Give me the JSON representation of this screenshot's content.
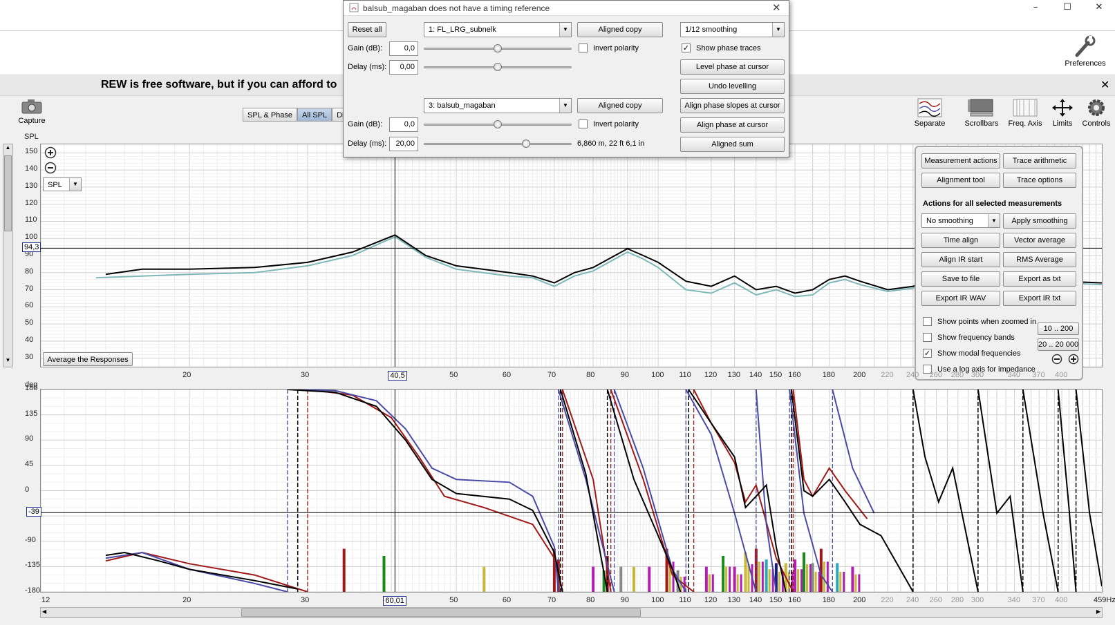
{
  "window": {
    "controls": [
      "–",
      "☐",
      "✕"
    ],
    "preferences_label": "Preferences",
    "banner": "REW is free software, but if you can afford to",
    "close_symbol": "✕"
  },
  "toolbar": {
    "capture_label": "Capture",
    "spl_axis_label": "SPL",
    "view_tabs": [
      "SPL & Phase",
      "All SPL",
      "Dist"
    ],
    "selected_tab": "All SPL",
    "right_tools": [
      "Separate",
      "Scrollbars",
      "Freq. Axis",
      "Limits",
      "Controls"
    ]
  },
  "dialog": {
    "title": "balsub_magaban does not have a timing reference",
    "reset_all": "Reset all",
    "meas1": {
      "name": "1: FL_LRG_subnelk",
      "aligned_copy": "Aligned copy",
      "gain_label": "Gain (dB):",
      "gain": "0,0",
      "invert_label": "Invert polarity",
      "delay_label": "Delay (ms):",
      "delay": "0,00"
    },
    "meas2": {
      "name": "3: balsub_magaban",
      "aligned_copy": "Aligned copy",
      "gain_label": "Gain (dB):",
      "gain": "0,0",
      "invert_label": "Invert polarity",
      "delay_label": "Delay (ms):",
      "delay": "20,00",
      "distance": "6,860 m, 22 ft 6,1 in"
    },
    "smoothing": "1/12 smoothing",
    "show_phase_traces": "Show phase traces",
    "show_phase_checked": true,
    "buttons": [
      "Level phase at cursor",
      "Undo levelling",
      "Align phase slopes at cursor",
      "Align phase at cursor",
      "Aligned sum"
    ]
  },
  "spl_chart": {
    "selector": "SPL",
    "y_ticks": [
      "150",
      "140",
      "130",
      "120",
      "110",
      "100",
      "90",
      "80",
      "70",
      "60",
      "50",
      "40",
      "30"
    ],
    "cursor_value": "94,3",
    "cursor_freq": "40,5",
    "x_ticks": [
      "20",
      "30",
      "40,5",
      "50",
      "60",
      "70",
      "80",
      "90",
      "100",
      "110",
      "120",
      "130",
      "140",
      "150",
      "160",
      "180",
      "200",
      "220",
      "240",
      "260",
      "280",
      "300",
      "340",
      "370",
      "400"
    ],
    "average_button": "Average the Responses"
  },
  "phase_chart": {
    "axis_label": "deg",
    "y_ticks": [
      "180",
      "135",
      "90",
      "45",
      "0",
      "-39",
      "-90",
      "-135",
      "-180"
    ],
    "cursor_value": "-39",
    "cursor_freq": "60,01",
    "x_ticks": [
      "12",
      "20",
      "30",
      "50",
      "60",
      "70",
      "80",
      "90",
      "100",
      "110",
      "120",
      "130",
      "140",
      "150",
      "160",
      "180",
      "200",
      "220",
      "240",
      "260",
      "280",
      "300",
      "340",
      "370",
      "400",
      "459Hz"
    ]
  },
  "panel": {
    "buttons_top": [
      "Measurement actions",
      "Trace arithmetic",
      "Alignment tool",
      "Trace options"
    ],
    "section_title": "Actions for all selected measurements",
    "smoothing": "No  smoothing",
    "buttons": [
      "Apply smoothing",
      "Time align",
      "Vector average",
      "Align IR start",
      "RMS Average",
      "Save to file",
      "Export as txt",
      "Export IR WAV",
      "Export IR txt"
    ],
    "checks": [
      {
        "label": "Show points when zoomed in",
        "checked": false
      },
      {
        "label": "Show frequency bands",
        "checked": false
      },
      {
        "label": "Show modal frequencies",
        "checked": true
      },
      {
        "label": "Use a log axis for impedance",
        "checked": false
      }
    ],
    "range_buttons": [
      "10 .. 200",
      "20 .. 20 000"
    ]
  },
  "colors": {
    "trace_black": "#000000",
    "trace_teal": "#7fb8b8",
    "trace_blue": "#4a4aa8",
    "trace_red": "#a01818"
  }
}
